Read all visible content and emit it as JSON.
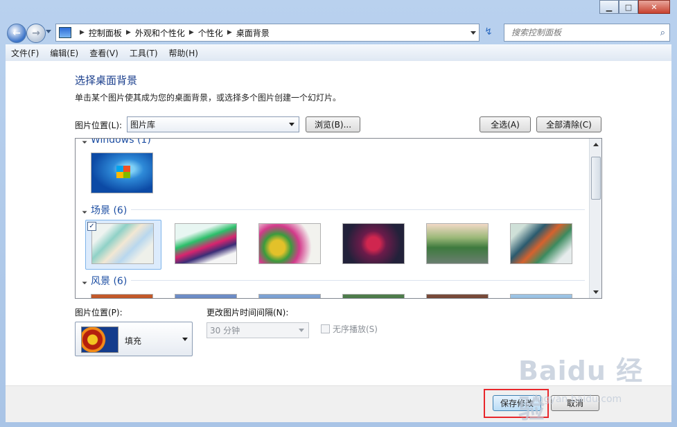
{
  "window": {
    "caption_buttons": {
      "minimize": "▁",
      "maximize": "□",
      "close": "✕"
    }
  },
  "nav": {
    "back_icon": "back-arrow-icon",
    "back_glyph": "←",
    "forward_glyph": "→",
    "breadcrumbs": [
      "控制面板",
      "外观和个性化",
      "个性化",
      "桌面背景"
    ],
    "search_placeholder": "搜索控制面板",
    "refresh_glyph": "↯",
    "search_glyph": "⌕"
  },
  "menu": [
    "文件(F)",
    "编辑(E)",
    "查看(V)",
    "工具(T)",
    "帮助(H)"
  ],
  "page": {
    "title": "选择桌面背景",
    "description": "单击某个图片使其成为您的桌面背景，或选择多个图片创建一个幻灯片。",
    "location_label": "图片位置(L):",
    "location_value": "图片库",
    "browse_label": "浏览(B)...",
    "select_all_label": "全选(A)",
    "clear_all_label": "全部清除(C)"
  },
  "gallery": {
    "groups": [
      {
        "name": "Windows (1)"
      },
      {
        "name": "场景 (6)"
      },
      {
        "name": "风景 (6)"
      }
    ],
    "selected_check": "✓"
  },
  "options": {
    "position_label": "图片位置(P):",
    "position_value": "填充",
    "interval_label": "更改图片时间间隔(N):",
    "interval_value": "30 分钟",
    "shuffle_label": "无序播放(S)"
  },
  "footer": {
    "save_label": "保存修改",
    "cancel_label": "取消"
  },
  "watermark": {
    "main": "Baidu 经验",
    "sub": "jingyan.baidu.com"
  },
  "colors": {
    "title_blue": "#1a3e8c",
    "group_blue": "#1e4fa3",
    "highlight_red": "#e8262b"
  }
}
